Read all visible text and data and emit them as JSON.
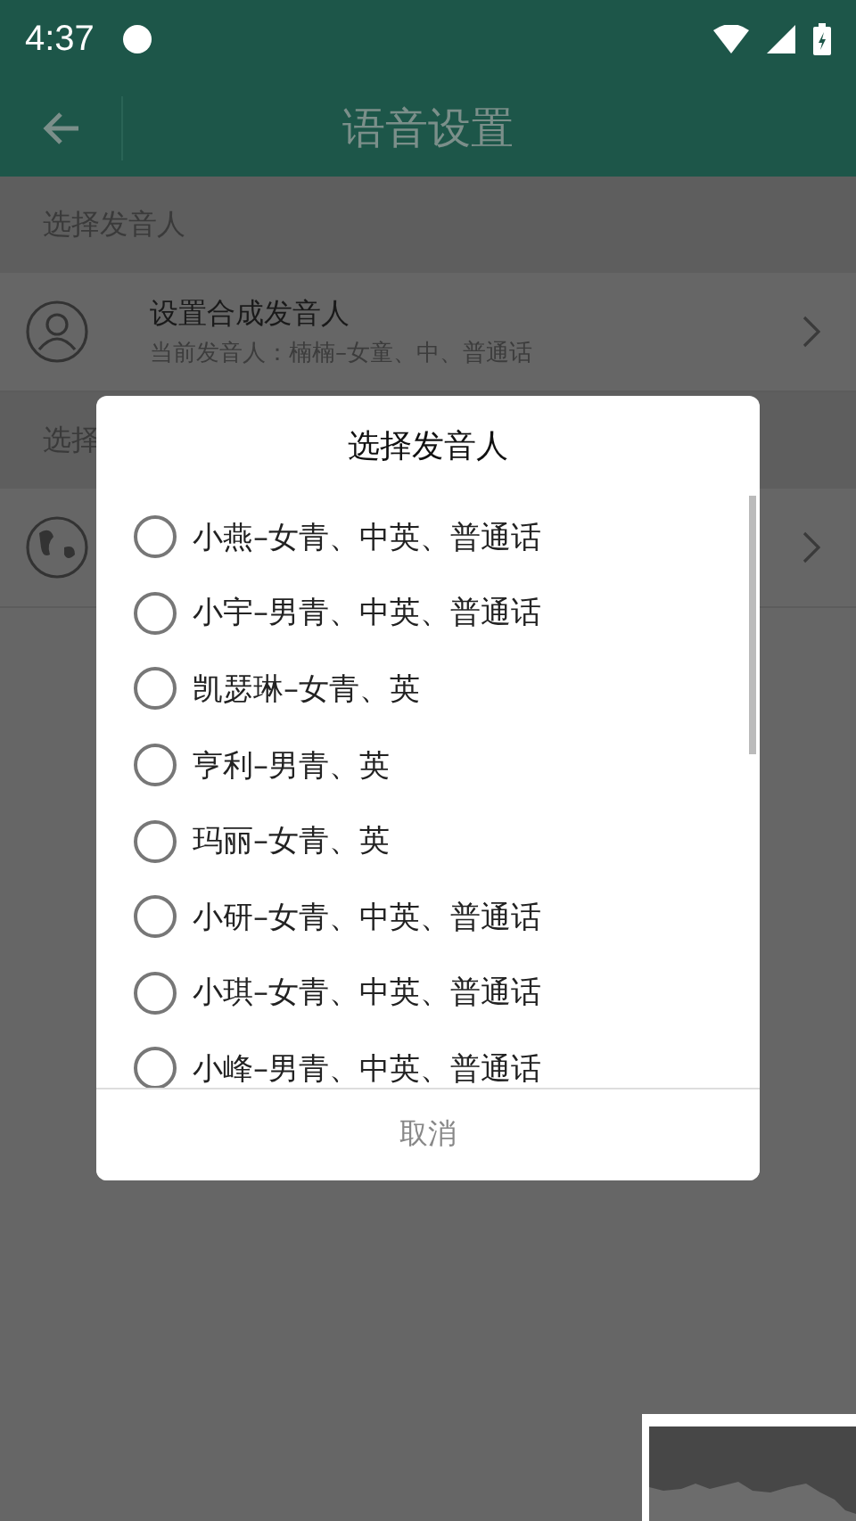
{
  "status_bar": {
    "time": "4:37"
  },
  "app_bar": {
    "title": "语音设置"
  },
  "sections": [
    {
      "header": "选择发音人",
      "rows": [
        {
          "kind": "person",
          "title": "设置合成发音人",
          "subtitle": "当前发音人：楠楠–女童、中、普通话"
        }
      ]
    },
    {
      "header": "选择",
      "rows": [
        {
          "kind": "globe"
        }
      ]
    }
  ],
  "dialog": {
    "title": "选择发音人",
    "options": [
      {
        "label": "小燕–女青、中英、普通话",
        "selected": false
      },
      {
        "label": "小宇–男青、中英、普通话",
        "selected": false
      },
      {
        "label": "凯瑟琳–女青、英",
        "selected": false
      },
      {
        "label": "亨利–男青、英",
        "selected": false
      },
      {
        "label": "玛丽–女青、英",
        "selected": false
      },
      {
        "label": "小研–女青、中英、普通话",
        "selected": false
      },
      {
        "label": "小琪–女青、中英、普通话",
        "selected": false
      },
      {
        "label": "小峰–男青、中英、普通话",
        "selected": false
      }
    ],
    "cancel": "取消"
  }
}
